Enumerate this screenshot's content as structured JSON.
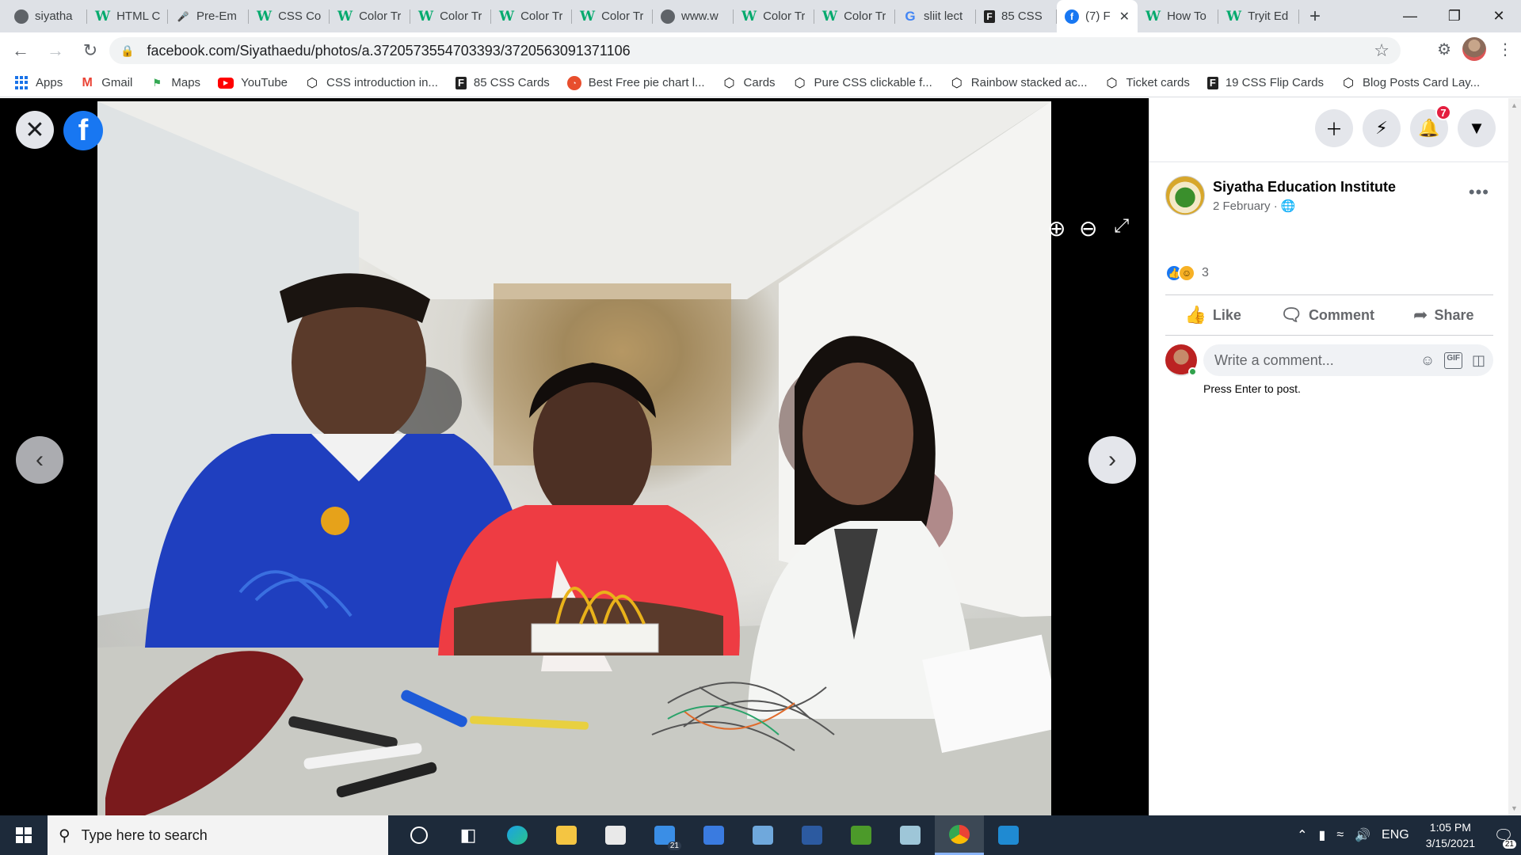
{
  "browser": {
    "tabs": [
      {
        "title": "siyatha",
        "icon": "globe-icon"
      },
      {
        "title": "HTML C",
        "icon": "w3schools-icon"
      },
      {
        "title": "Pre-Em",
        "icon": "microphone-icon"
      },
      {
        "title": "CSS Col",
        "icon": "w3schools-icon"
      },
      {
        "title": "Color Tr",
        "icon": "w3schools-icon"
      },
      {
        "title": "Color Tr",
        "icon": "w3schools-icon"
      },
      {
        "title": "Color Tr",
        "icon": "w3schools-icon"
      },
      {
        "title": "Color Tr",
        "icon": "w3schools-icon"
      },
      {
        "title": "www.w",
        "icon": "globe-icon"
      },
      {
        "title": "Color Tr",
        "icon": "w3schools-icon"
      },
      {
        "title": "Color Tr",
        "icon": "w3schools-icon"
      },
      {
        "title": "sliit lect",
        "icon": "google-icon"
      },
      {
        "title": "85 CSS",
        "icon": "f-logo-icon"
      },
      {
        "title": "(7) F",
        "icon": "facebook-icon",
        "active": true
      },
      {
        "title": "How To",
        "icon": "w3schools-icon"
      },
      {
        "title": "Tryit Ed",
        "icon": "w3schools-icon"
      }
    ],
    "url": "facebook.com/Siyathaedu/photos/a.3720573554703393/3720563091371106",
    "bookmarks": [
      {
        "label": "Apps",
        "icon": "apps-grid-icon"
      },
      {
        "label": "Gmail",
        "icon": "gmail-icon"
      },
      {
        "label": "Maps",
        "icon": "maps-icon"
      },
      {
        "label": "YouTube",
        "icon": "youtube-icon"
      },
      {
        "label": "CSS introduction in...",
        "icon": "codepen-icon"
      },
      {
        "label": "85 CSS Cards",
        "icon": "f-logo-icon"
      },
      {
        "label": "Best Free pie chart l...",
        "icon": "pie-chart-icon"
      },
      {
        "label": "Cards",
        "icon": "codepen-icon"
      },
      {
        "label": "Pure CSS clickable f...",
        "icon": "codepen-icon"
      },
      {
        "label": "Rainbow stacked ac...",
        "icon": "codepen-icon"
      },
      {
        "label": "Ticket cards",
        "icon": "codepen-icon"
      },
      {
        "label": "19 CSS Flip Cards",
        "icon": "f-logo-icon"
      },
      {
        "label": "Blog Posts Card Lay...",
        "icon": "codepen-icon"
      }
    ]
  },
  "facebook": {
    "notification_count": "7",
    "post": {
      "author": "Siyatha Education Institute",
      "date": "2 February · ",
      "reaction_count": "3",
      "actions": {
        "like": "Like",
        "comment": "Comment",
        "share": "Share"
      },
      "comment_placeholder": "Write a comment...",
      "press_enter_hint": "Press Enter to post."
    }
  },
  "taskbar": {
    "search_placeholder": "Type here to search",
    "mail_badge": "21",
    "language": "ENG",
    "time": "1:05 PM",
    "date": "3/15/2021",
    "notification_badge": "21"
  },
  "colors": {
    "facebook_blue": "#1877f2",
    "notification_red": "#e41e3f",
    "taskbar_bg": "#1d2a3a"
  }
}
